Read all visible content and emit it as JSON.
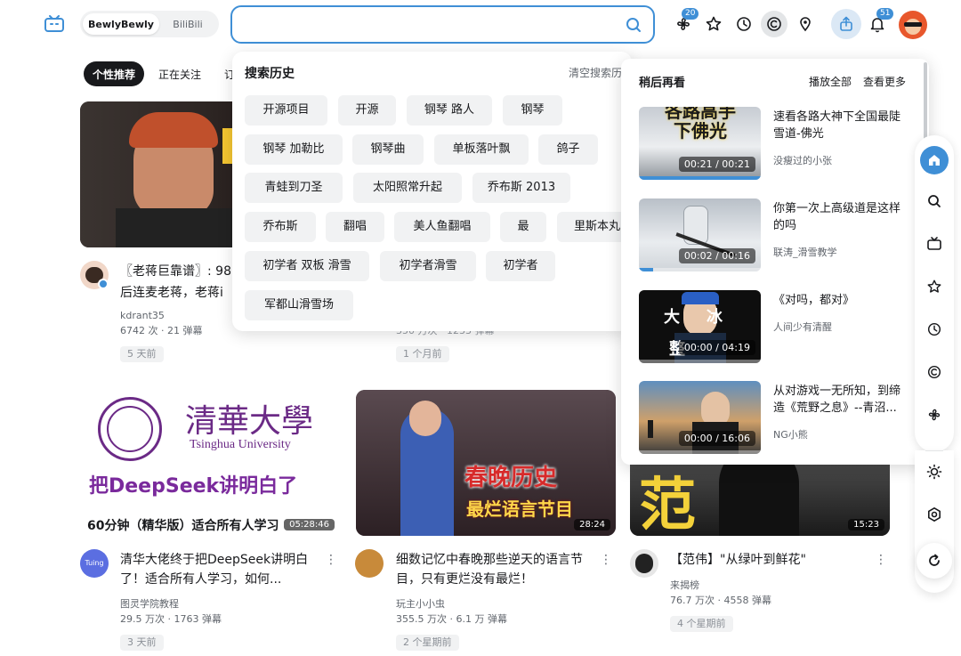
{
  "header": {
    "tabs": [
      {
        "label": "BewlyBewly",
        "active": true
      },
      {
        "label": "BiliBili",
        "active": false
      }
    ],
    "search": {
      "value": "",
      "placeholder": ""
    },
    "badges": {
      "moments": "20",
      "notifications": "51"
    },
    "accent": "#3f8fd6"
  },
  "categories": [
    {
      "label": "个性推荐",
      "active": true
    },
    {
      "label": "正在关注",
      "active": false
    },
    {
      "label": "订",
      "active": false
    }
  ],
  "search_history": {
    "title": "搜索历史",
    "clear_label": "清空搜索历",
    "items": [
      "开源项目",
      "开源",
      "钢琴 路人",
      "钢琴",
      "钢琴 加勒比",
      "钢琴曲",
      "单板落叶飘",
      "鸽子",
      "青蛙到刀圣",
      "太阳照常升起",
      "乔布斯 2013",
      "乔布斯",
      "翻唱",
      "美人鱼翻唱",
      "最",
      "里斯本丸",
      "初学者 双板 滑雪",
      "初学者滑雪",
      "初学者",
      "军都山滑雪场"
    ]
  },
  "watch_later": {
    "title": "稍后再看",
    "play_all": "播放全部",
    "see_more": "查看更多",
    "items": [
      {
        "title": "速看各路大神下全国最陡雪道-佛光",
        "author": "没瘦过的小张",
        "duration": "00:21 / 00:21",
        "progress": 1.0,
        "thumb_text": "各路高手\n下佛光"
      },
      {
        "title": "你第一次上高级道是这样的吗",
        "author": "联涛_滑雪教学",
        "duration": "00:02 / 00:16",
        "progress": 0.12,
        "thumb_text": ""
      },
      {
        "title": "《对吗，都对》",
        "author": "人间少有清醒",
        "duration": "00:00 / 04:19",
        "progress": 0,
        "thumb_text": "大 冰"
      },
      {
        "title": "从对游戏一无所知，到缔造《荒野之息》--青沼...",
        "author": "NG小熊",
        "duration": "00:00 / 16:06",
        "progress": 0,
        "thumb_text": ""
      }
    ]
  },
  "videos": [
    {
      "title": "〖老蒋巨靠谱〗: 98",
      "title2": "后连麦老蒋，老蒋i",
      "author": "kdrant35",
      "stats": "6742 次 · 21 弹幕",
      "age": "5 天前",
      "duration": ""
    },
    {
      "title": "",
      "title2": "",
      "author": "",
      "stats": "350 万次 · 1233 弹幕",
      "age": "1 个月前",
      "duration": ""
    },
    {
      "title": "清华大佬终于把DeepSeek讲明白了！适合所有人学习，如何...",
      "author": "图灵学院教程",
      "stats": "29.5 万次 · 1763 弹幕",
      "age": "3 天前",
      "duration": "05:28:46",
      "thumb_line1": "清華大學",
      "thumb_line2": "Tsinghua University",
      "thumb_line3": "把DeepSeek讲明白了",
      "thumb_line4": "60分钟（精华版）适合所有人学习"
    },
    {
      "title": "细数记忆中春晚那些逆天的语言节目，只有更烂没有最烂！",
      "author": "玩主小小虫",
      "stats": "355.5 万次 · 6.1 万 弹幕",
      "age": "2 个星期前",
      "duration": "28:24",
      "thumb_line1": "春晚历史",
      "thumb_line2": "最烂语言节目"
    },
    {
      "title": "【范伟】\"从绿叶到鲜花\"",
      "author": "来揭榜",
      "stats": "76.7 万次 · 4558 弹幕",
      "age": "4 个星期前",
      "duration": "15:23",
      "thumb_line1": "范伟"
    }
  ],
  "icons": {
    "logo": "tv-icon",
    "search": "search-icon",
    "moments": "pinwheel-icon",
    "favorites": "star-icon",
    "history": "clock-icon",
    "watch_later": "c-icon",
    "location": "pin-icon",
    "upload": "upload-icon",
    "bell": "bell-icon"
  }
}
